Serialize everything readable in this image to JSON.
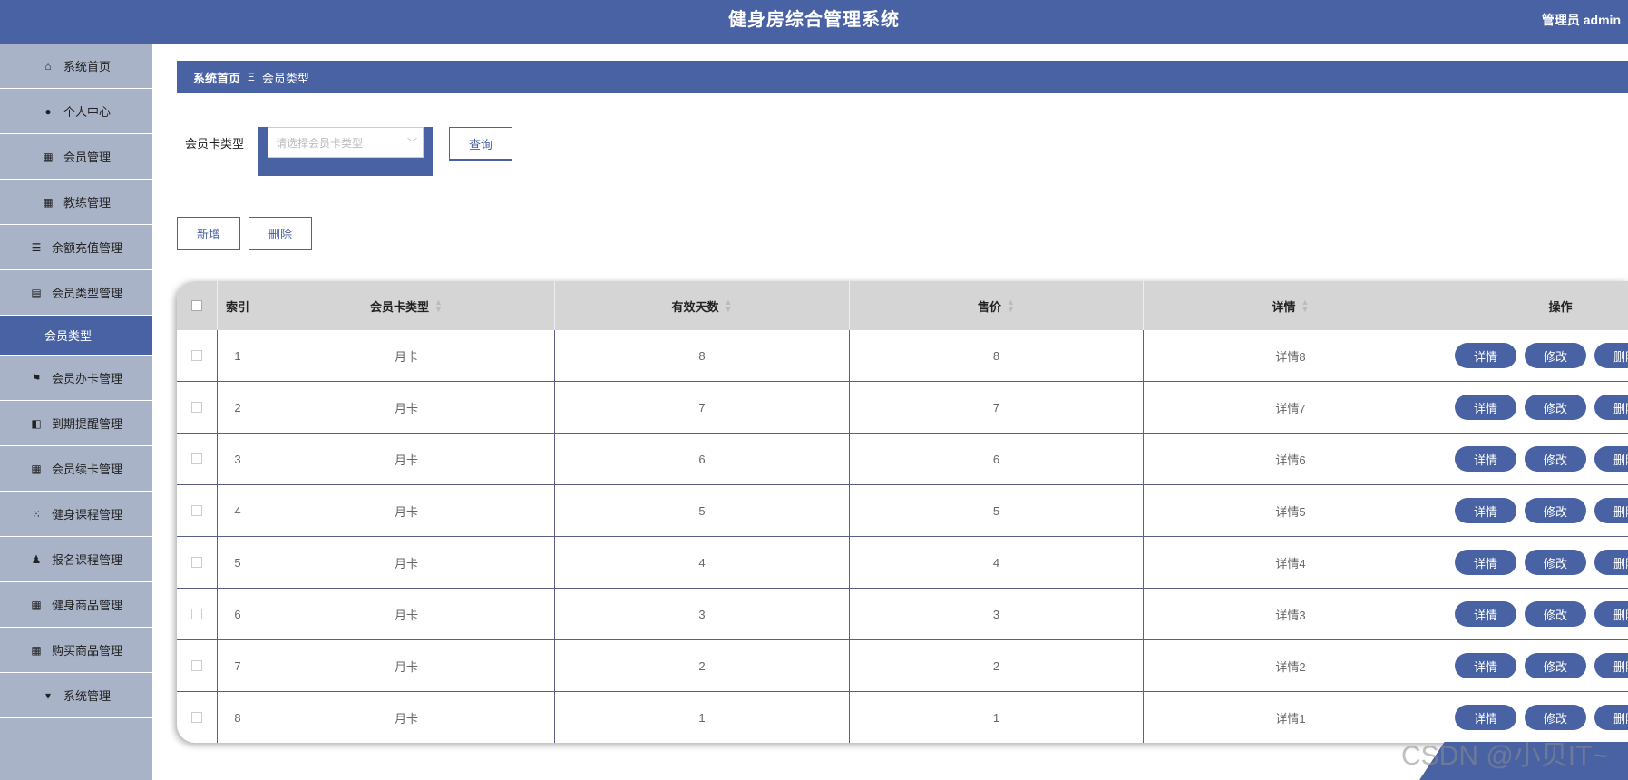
{
  "header": {
    "title": "健身房综合管理系统",
    "user": "管理员 admin"
  },
  "sidebar": {
    "items": [
      {
        "label": "系统首页",
        "icon": "home-icon"
      },
      {
        "label": "个人中心",
        "icon": "user-icon"
      },
      {
        "label": "会员管理",
        "icon": "grid-icon"
      },
      {
        "label": "教练管理",
        "icon": "grid-icon"
      },
      {
        "label": "余额充值管理",
        "icon": "list-icon"
      },
      {
        "label": "会员类型管理",
        "icon": "clipboard-icon"
      }
    ],
    "sub_item": "会员类型",
    "items2": [
      {
        "label": "会员办卡管理",
        "icon": "flag-icon"
      },
      {
        "label": "到期提醒管理",
        "icon": "wallet-icon"
      },
      {
        "label": "会员续卡管理",
        "icon": "grid-icon"
      },
      {
        "label": "健身课程管理",
        "icon": "apps-icon"
      },
      {
        "label": "报名课程管理",
        "icon": "person-icon"
      },
      {
        "label": "健身商品管理",
        "icon": "grid-icon"
      },
      {
        "label": "购买商品管理",
        "icon": "grid-icon"
      },
      {
        "label": "系统管理",
        "icon": "stand-icon"
      }
    ]
  },
  "breadcrumb": {
    "home": "系统首页",
    "separator": "Ξ",
    "current": "会员类型"
  },
  "filter": {
    "label": "会员卡类型",
    "placeholder": "请选择会员卡类型",
    "query_button": "查询"
  },
  "actions": {
    "add": "新增",
    "delete": "删除"
  },
  "table": {
    "headers": {
      "index": "索引",
      "type": "会员卡类型",
      "days": "有效天数",
      "price": "售价",
      "detail": "详情",
      "ops": "操作"
    },
    "row_buttons": {
      "detail": "详情",
      "edit": "修改",
      "delete": "删除"
    },
    "rows": [
      {
        "index": "1",
        "type": "月卡",
        "days": "8",
        "price": "8",
        "detail": "详情8"
      },
      {
        "index": "2",
        "type": "月卡",
        "days": "7",
        "price": "7",
        "detail": "详情7"
      },
      {
        "index": "3",
        "type": "月卡",
        "days": "6",
        "price": "6",
        "detail": "详情6"
      },
      {
        "index": "4",
        "type": "月卡",
        "days": "5",
        "price": "5",
        "detail": "详情5"
      },
      {
        "index": "5",
        "type": "月卡",
        "days": "4",
        "price": "4",
        "detail": "详情4"
      },
      {
        "index": "6",
        "type": "月卡",
        "days": "3",
        "price": "3",
        "detail": "详情3"
      },
      {
        "index": "7",
        "type": "月卡",
        "days": "2",
        "price": "2",
        "detail": "详情2"
      },
      {
        "index": "8",
        "type": "月卡",
        "days": "1",
        "price": "1",
        "detail": "详情1"
      }
    ]
  },
  "watermark": "CSDN @小贝IT~",
  "colors": {
    "primary": "#4862a3",
    "sidebar": "#a9b3c8",
    "header_row": "#d5d5d5"
  }
}
